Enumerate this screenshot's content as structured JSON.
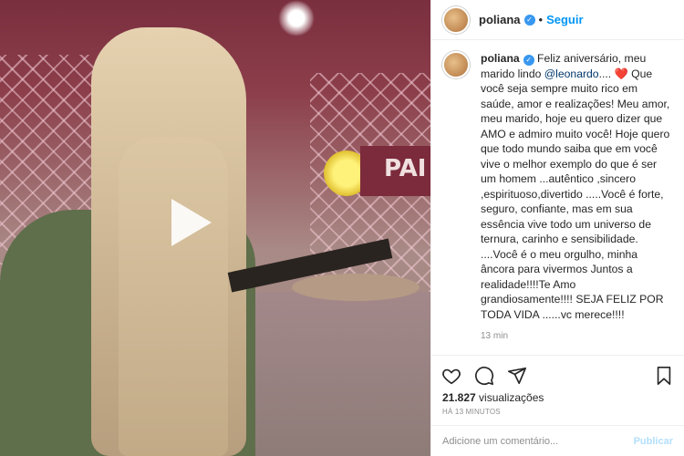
{
  "post": {
    "username": "poliana",
    "follow_label": "Seguir",
    "dot": "•",
    "more": "•••",
    "caption": {
      "author": "poliana",
      "text_before_mention": " Feliz aniversário, meu marido lindo ",
      "mention": "@leonardo",
      "text_after_mention": ".... ",
      "heart": "❤️",
      "text_rest": " Que você seja sempre muito rico em saúde, amor e realizações! Meu amor, meu marido, hoje eu quero dizer que AMO e admiro muito você! Hoje quero que todo mundo saiba que em você vive o melhor exemplo do que é ser um homem ...autêntico ,sincero ,espirituoso,divertido .....Você é forte, seguro, confiante, mas em sua essência vive todo um universo de ternura, carinho e sensibilidade. ....Você é o meu orgulho, minha âncora para vivermos Juntos a realidade!!!!Te Amo grandiosamente!!!! SEJA FELIZ POR TODA VIDA ......vc merece!!!!",
      "time": "13 min"
    },
    "views_count": "21.827",
    "views_label": " visualizações",
    "posted_ago": "HÁ 13 MINUTOS",
    "comment_placeholder": "Adicione um comentário...",
    "publish_label": "Publicar"
  },
  "video": {
    "sign_text": "PAI"
  },
  "icons": {
    "like": "heart-outline-icon",
    "comment": "comment-bubble-icon",
    "share": "paper-plane-icon",
    "save": "bookmark-icon",
    "verified": "verified-badge-icon"
  },
  "colors": {
    "accent": "#0095f6",
    "verified": "#3897f0",
    "muted": "#8e8e8e",
    "publish_disabled": "#b2dffc"
  }
}
